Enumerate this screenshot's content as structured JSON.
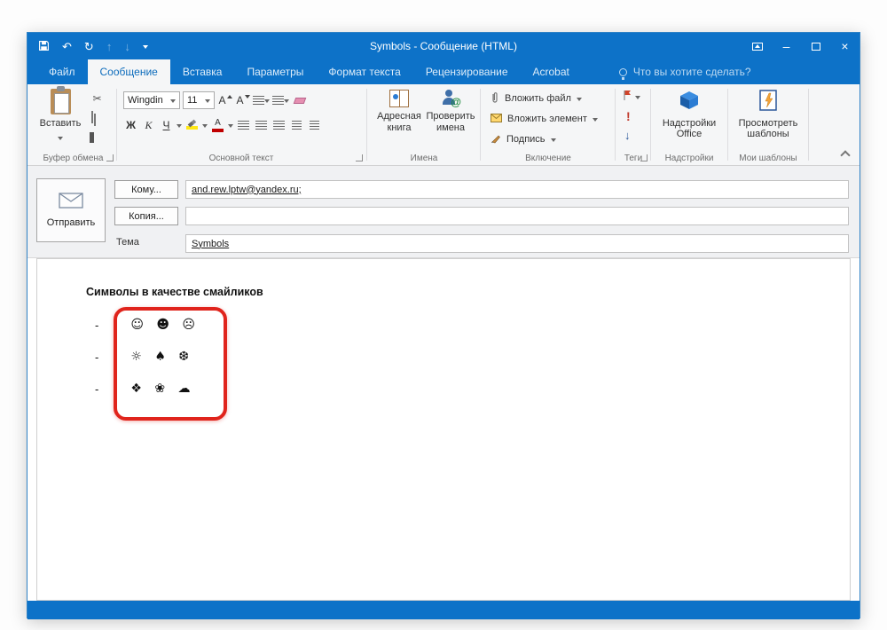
{
  "titlebar": {
    "title": "Symbols - Сообщение (HTML)"
  },
  "icons": {
    "undo": "↶",
    "redo": "↻",
    "prev": "↑",
    "next": "↓",
    "minimize": "–",
    "close": "×",
    "scissors": "✂",
    "exclamation": "!",
    "down_arrow": "↓",
    "check": "✓"
  },
  "tabs": [
    {
      "label": "Файл"
    },
    {
      "label": "Сообщение"
    },
    {
      "label": "Вставка"
    },
    {
      "label": "Параметры"
    },
    {
      "label": "Формат текста"
    },
    {
      "label": "Рецензирование"
    },
    {
      "label": "Acrobat"
    }
  ],
  "tellme": "Что вы хотите сделать?",
  "ribbon": {
    "clipboard": {
      "group": "Буфер обмена",
      "paste": "Вставить"
    },
    "font": {
      "group": "Основной текст",
      "family": "Wingdin",
      "size": "11",
      "bold": "Ж",
      "italic": "К",
      "underline": "Ч",
      "grow": "А",
      "shrink": "А",
      "color": "А"
    },
    "names": {
      "group": "Имена",
      "address_book": "Адресная книга",
      "check_names": "Проверить имена"
    },
    "include": {
      "group": "Включение",
      "attach_file": "Вложить файл",
      "attach_item": "Вложить элемент",
      "signature": "Подпись"
    },
    "tags": {
      "group": "Теги"
    },
    "addins": {
      "group": "Надстройки",
      "button": "Надстройки Office"
    },
    "templates": {
      "group": "Мои шаблоны",
      "button": "Просмотреть шаблоны"
    }
  },
  "compose": {
    "send": "Отправить",
    "to": "Кому...",
    "cc": "Копия...",
    "subject_label": "Тема",
    "to_value": "and.rew.lptw@yandex.ru;",
    "cc_value": "",
    "subject_value": "Symbols"
  },
  "message": {
    "heading": "Символы в качестве смайликов",
    "rows": [
      {
        "bullet": "-",
        "symbols": "☺ ☻ ☹"
      },
      {
        "bullet": "-",
        "symbols": "☼ ♠ ❆"
      },
      {
        "bullet": "-",
        "symbols": "❖ ❀ ☁"
      }
    ]
  }
}
